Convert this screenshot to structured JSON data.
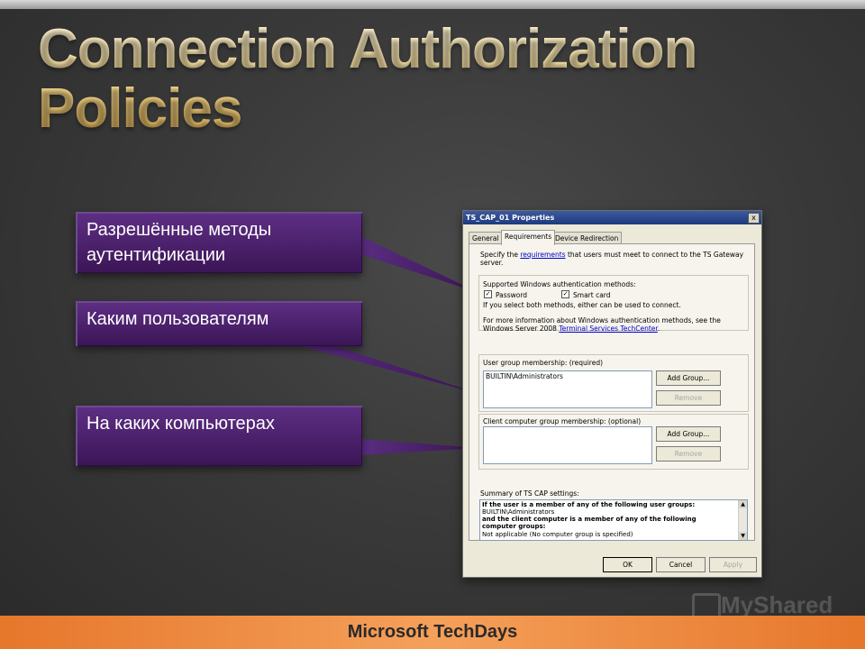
{
  "slide": {
    "title_line1": "Connection Authorization",
    "title_line2": "Policies",
    "callouts": [
      {
        "text": "Разрешённые методы аутентификации"
      },
      {
        "text": "Каким пользователям"
      },
      {
        "text": "На каких компьютерах"
      }
    ],
    "footer": "Microsoft TechDays",
    "watermark": "MyShared"
  },
  "dialog": {
    "title": "TS_CAP_01 Properties",
    "close_label": "x",
    "tabs": [
      {
        "label": "General"
      },
      {
        "label": "Requirements"
      },
      {
        "label": "Device Redirection"
      }
    ],
    "intro_prefix": "Specify the",
    "intro_link": "requirements",
    "intro_suffix": "that users must meet to connect to the TS Gateway",
    "intro_line2": "server.",
    "auth_group_label": "Supported Windows authentication methods:",
    "password_label": "Password",
    "smartcard_label": "Smart card",
    "checkmark": "✓",
    "both_note": "If you select both methods, either can be used to connect.",
    "more_info_line1": "For more information about Windows authentication methods, see the",
    "more_info_prefix": "Windows Server 2008",
    "more_info_link": "Terminal Services TechCenter",
    "more_info_suffix": ".",
    "user_group_label": "User group membership: (required)",
    "user_group_items": [
      "BUILTIN\\Administrators"
    ],
    "add_group_label": "Add Group...",
    "remove_label": "Remove",
    "client_group_label": "Client computer group membership: (optional)",
    "summary_label": "Summary of TS CAP settings:",
    "summary_lines": [
      "If the user is a member of any of the following user groups:",
      "BUILTIN\\Administrators",
      "and the client computer is a member of any of the following",
      "computer groups:",
      "Not applicable (No computer group is specified)"
    ],
    "ok_label": "OK",
    "cancel_label": "Cancel",
    "apply_label": "Apply"
  },
  "colors": {
    "callout_bg": "#4a1f6b",
    "title_gold": "#f3d68c",
    "footer_orange": "#f08a3c"
  }
}
